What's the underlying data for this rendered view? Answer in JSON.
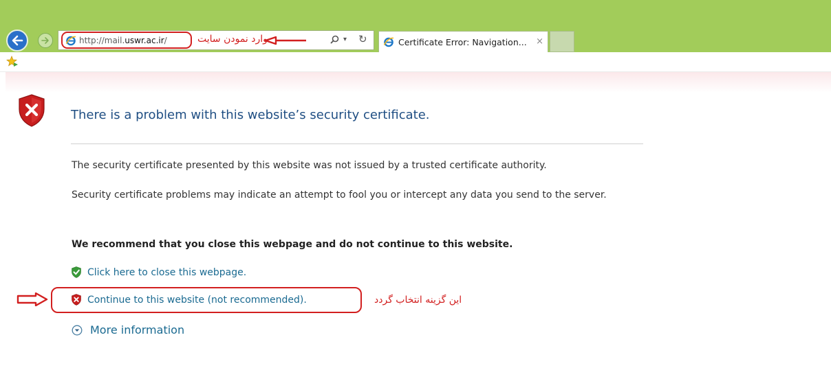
{
  "browser": {
    "address": {
      "url_prefix": "http://mail.",
      "url_host": "uswr.ac.ir",
      "url_suffix": "/",
      "annotation": "وارد نمودن سایت"
    },
    "tab": {
      "title": "Certificate Error: Navigation...",
      "close_glyph": "×"
    },
    "refresh_glyph": "↻",
    "dropdown_glyph": "▾"
  },
  "page": {
    "title": "There is a problem with this website’s security certificate.",
    "paragraph1": "The security certificate presented by this website was not issued by a trusted certificate authority.",
    "paragraph2": "Security certificate problems may indicate an attempt to fool you or intercept any data you send to the server.",
    "recommendation": "We recommend that you close this webpage and do not continue to this website.",
    "close_link": "Click here to close this webpage.",
    "continue_link": "Continue to this website (not recommended).",
    "continue_annotation": "این گزینه انتخاب گردد",
    "more_info": "More information"
  },
  "colors": {
    "chrome_green": "#a2cc5a",
    "annotation_red": "#d21f1f",
    "link_blue": "#1a6a91",
    "title_blue": "#1f4e83"
  },
  "icons": {
    "back": "back-arrow-icon",
    "forward": "forward-arrow-icon",
    "ie_logo": "ie-logo-icon",
    "search": "search-icon",
    "refresh": "refresh-icon",
    "favorites": "add-favorites-star-icon",
    "error_shield": "red-shield-x-icon",
    "safe_shield": "green-shield-check-icon",
    "warning_shield": "red-shield-x-small-icon",
    "expand": "circle-chevron-down-icon"
  }
}
